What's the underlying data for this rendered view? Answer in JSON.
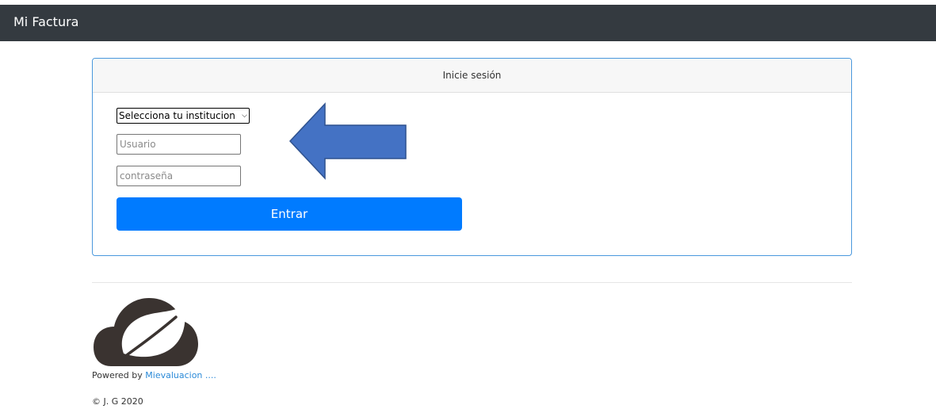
{
  "navbar": {
    "brand": "Mi Factura"
  },
  "login": {
    "header": "Inicie sesión",
    "institution_select": {
      "value": "Selecciona tu institucion"
    },
    "username": {
      "placeholder": "Usuario",
      "value": ""
    },
    "password": {
      "placeholder": "contraseña",
      "value": ""
    },
    "submit_label": "Entrar"
  },
  "footer": {
    "powered_prefix": "Powered by ",
    "powered_link": "Mievaluacion ....",
    "copyright": "© J. G 2020"
  },
  "colors": {
    "navbar": "#343a40",
    "primary": "#007bff",
    "arrow_fill": "#4472c4",
    "arrow_stroke": "#2f528f",
    "logo": "#3a3330",
    "link": "#2b8ad8"
  },
  "icons": {
    "arrow": "left-arrow-icon",
    "logo": "cloud-leaf-logo",
    "select": "chevron-down-icon"
  }
}
